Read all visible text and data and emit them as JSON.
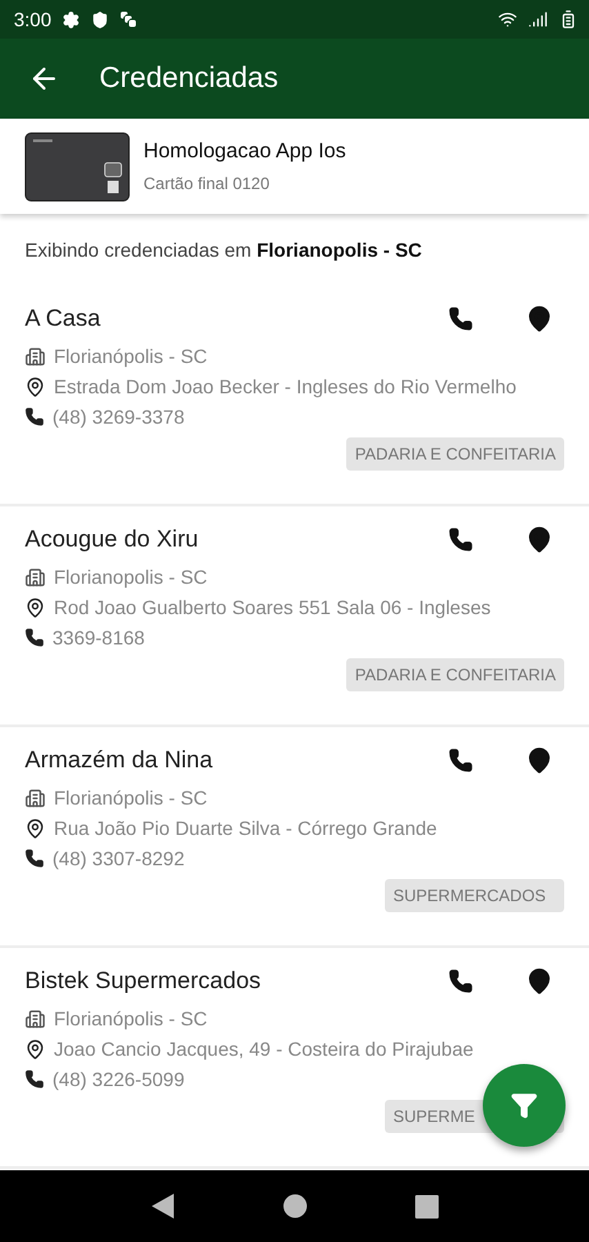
{
  "status_bar": {
    "time": "3:00"
  },
  "app_bar": {
    "title": "Credenciadas"
  },
  "card": {
    "name": "Homologacao App Ios",
    "subtitle": "Cartão final 0120"
  },
  "info": "Exibindo credenciadas em **Florianopolis - SC**",
  "establishments": [
    {
      "name": "A Casa",
      "city": "Florianópolis - SC",
      "address": "Estrada Dom Joao Becker - Ingleses do Rio Vermelho",
      "phone": "(48) 3269-3378",
      "category": "PADARIA E CONFEITARIA"
    },
    {
      "name": "Acougue do Xiru",
      "city": "Florianopolis - SC",
      "address": "Rod Joao Gualberto Soares 551 Sala 06 - Ingleses",
      "phone": "3369-8168",
      "category": "PADARIA E CONFEITARIA"
    },
    {
      "name": "Armazém da Nina",
      "city": "Florianópolis - SC",
      "address": "Rua João Pio Duarte Silva - Córrego Grande",
      "phone": "(48) 3307-8292",
      "category": "SUPERMERCADOS"
    },
    {
      "name": "Bistek Supermercados",
      "city": "Florianópolis - SC",
      "address": "Joao Cancio Jacques, 49 - Costeira do Pirajubae",
      "phone": "(48) 3226-5099",
      "category": "SUPERME"
    }
  ]
}
